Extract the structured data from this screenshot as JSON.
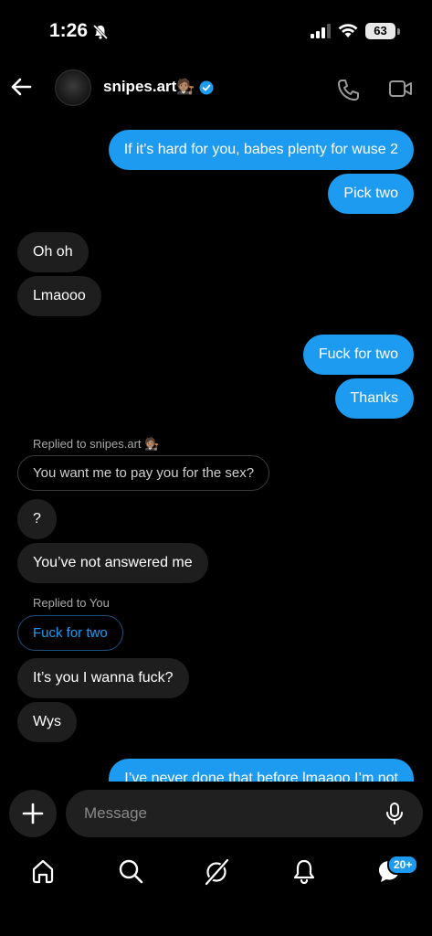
{
  "status": {
    "time": "1:26",
    "battery": "63"
  },
  "header": {
    "username": "snipes.art",
    "username_emoji": "🧑🏽‍⚖️"
  },
  "messages": {
    "m1": "If it’s hard for you, babes plenty for wuse 2",
    "m2": "Pick two",
    "m3": "Oh oh",
    "m4": "Lmaooo",
    "m5": "Fuck for two",
    "m6": "Thanks",
    "reply1_label": "Replied to snipes.art",
    "reply1_emoji": "🧑🏽‍⚖️",
    "reply1_quote": "You want me to pay you for the sex?",
    "m7": "?",
    "m8": "You’ve not answered me",
    "reply2_label": "Replied to You",
    "reply2_quote": "Fuck for two",
    "m9": "It’s you I wanna fuck?",
    "m10": "Wys",
    "m11": "I’ve never done that before lmaaoo I’m not"
  },
  "composer": {
    "placeholder": "Message"
  },
  "tabbar": {
    "badge": "20+"
  },
  "colors": {
    "accent": "#1d9bf0",
    "incoming_bubble": "#1e1e1e",
    "background": "#000000"
  }
}
